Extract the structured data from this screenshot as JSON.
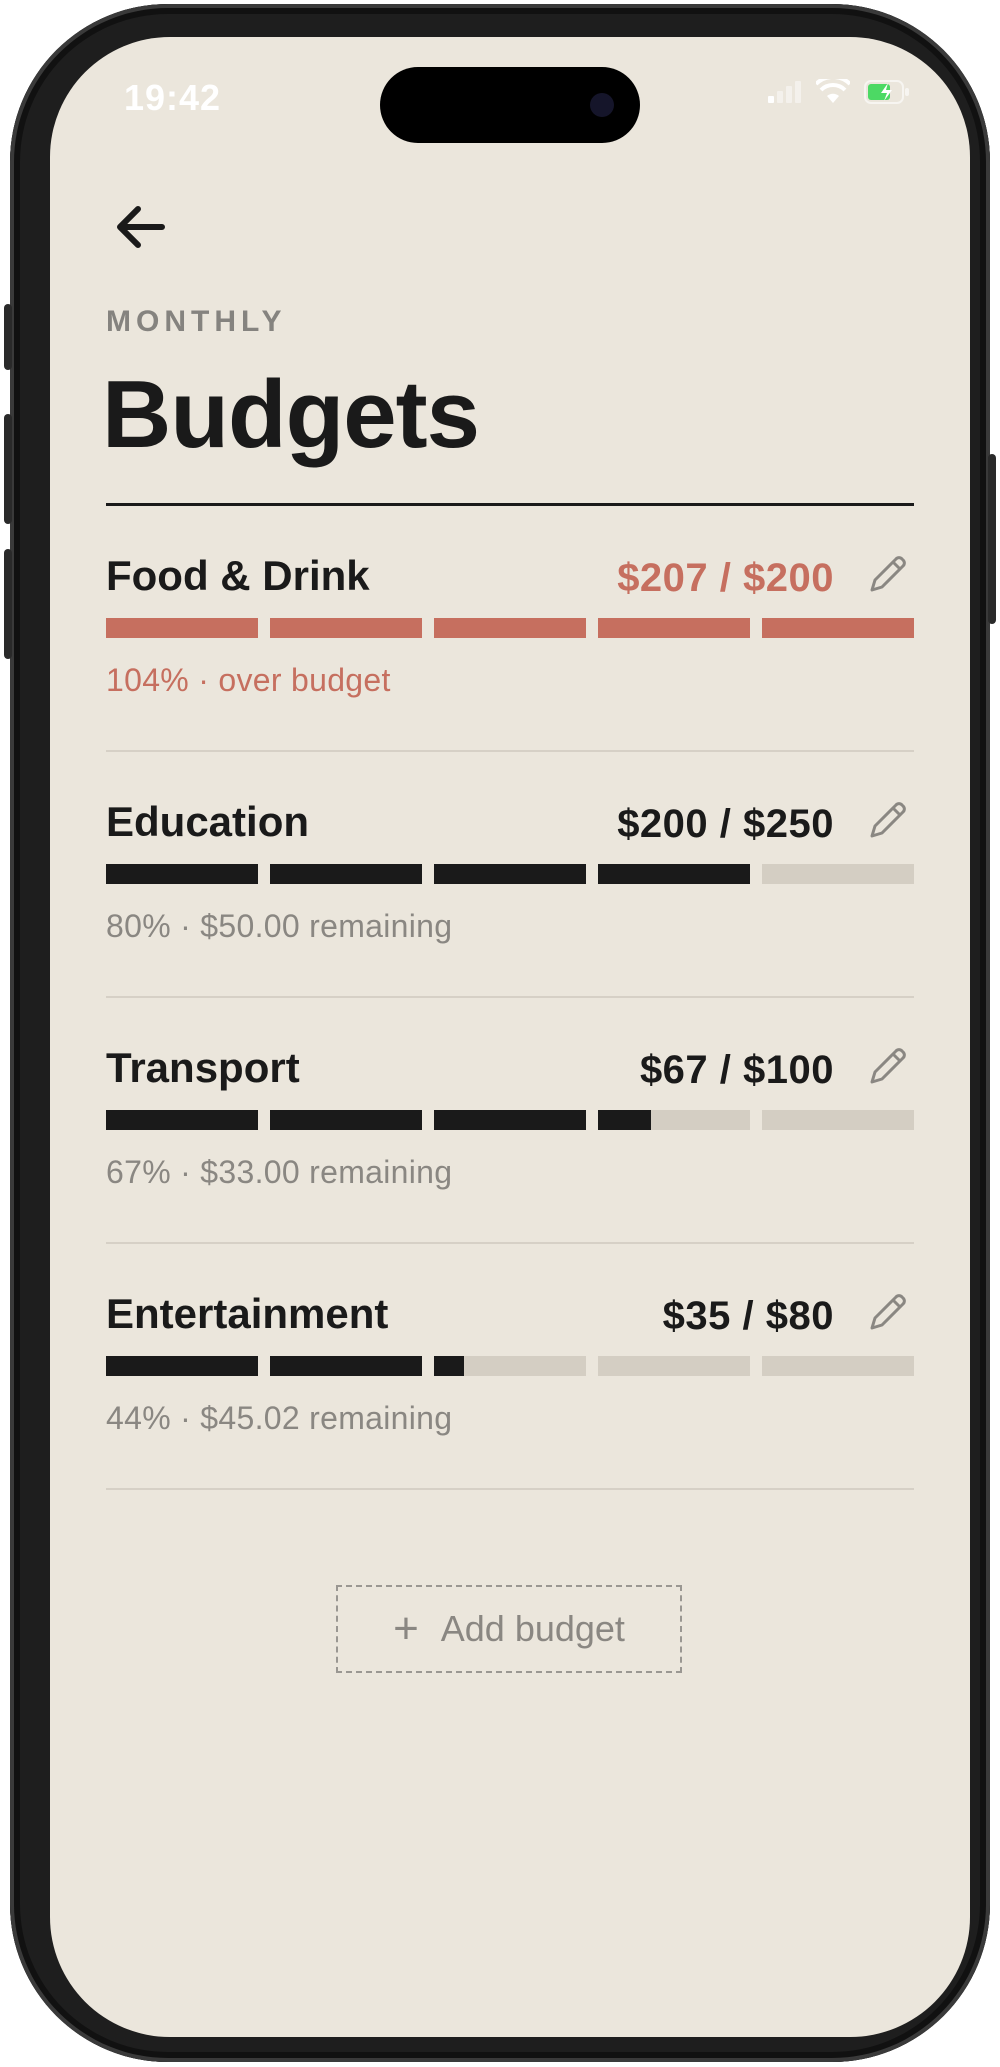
{
  "status_bar": {
    "time": "19:42"
  },
  "header": {
    "eyebrow": "MONTHLY",
    "title": "Budgets"
  },
  "colors": {
    "background": "#ebe6dc",
    "ink": "#1a1a1a",
    "over": "#c66f5f",
    "track": "#d4cec3",
    "muted": "#8a8782"
  },
  "budgets": [
    {
      "name": "Food & Drink",
      "amount": "$207 / $200",
      "caption": "104% · over budget",
      "progress": 1.04,
      "over": true
    },
    {
      "name": "Education",
      "amount": "$200 / $250",
      "caption": "80% · $50.00 remaining",
      "progress": 0.8,
      "over": false
    },
    {
      "name": "Transport",
      "amount": "$67 / $100",
      "caption": "67% · $33.00 remaining",
      "progress": 0.67,
      "over": false
    },
    {
      "name": "Entertainment",
      "amount": "$35 / $80",
      "caption": "44% · $45.02 remaining",
      "progress": 0.44,
      "over": false
    }
  ],
  "actions": {
    "add_budget": "Add budget"
  },
  "icons": {
    "back": "arrow-left-icon",
    "edit": "pencil-icon",
    "add": "plus-icon"
  }
}
